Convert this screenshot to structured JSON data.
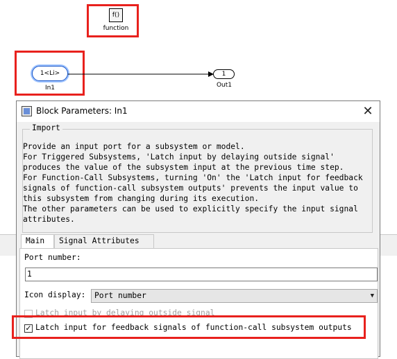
{
  "canvas": {
    "function_block": {
      "text": "f()",
      "label": "function"
    },
    "inport": {
      "text": "1<Li>",
      "label": "In1"
    },
    "outport": {
      "text": "1",
      "label": "Out1"
    }
  },
  "dialog": {
    "title": "Block Parameters: In1",
    "close_glyph": "✕",
    "group_title": "Import",
    "description": [
      "Provide an input port for a subsystem or model.",
      "For Triggered Subsystems, 'Latch input by delaying outside signal'",
      "produces the value of the subsystem input at the previous time step.",
      "For Function-Call Subsystems, turning 'On' the 'Latch input for feedback",
      "signals of function-call subsystem outputs' prevents the input value to",
      "this subsystem from changing during its execution.",
      "The other parameters can be used to explicitly specify the input signal",
      "attributes."
    ],
    "tabs": [
      {
        "label": "Main",
        "active": true
      },
      {
        "label": "Signal Attributes",
        "active": false
      }
    ],
    "port_number_label": "Port number:",
    "port_number_value": "1",
    "icon_display_label": "Icon display:",
    "icon_display_value": "Port number",
    "latch_delay_label": "Latch input by delaying outside signal",
    "latch_delay_checked": false,
    "latch_feedback_label": "Latch input for feedback signals of function-call subsystem outputs",
    "latch_feedback_checked": true,
    "check_glyph": "✓",
    "dropdown_glyph": "▼"
  },
  "colors": {
    "highlight": "#e8211d",
    "port_selected": "#1b57c8"
  }
}
